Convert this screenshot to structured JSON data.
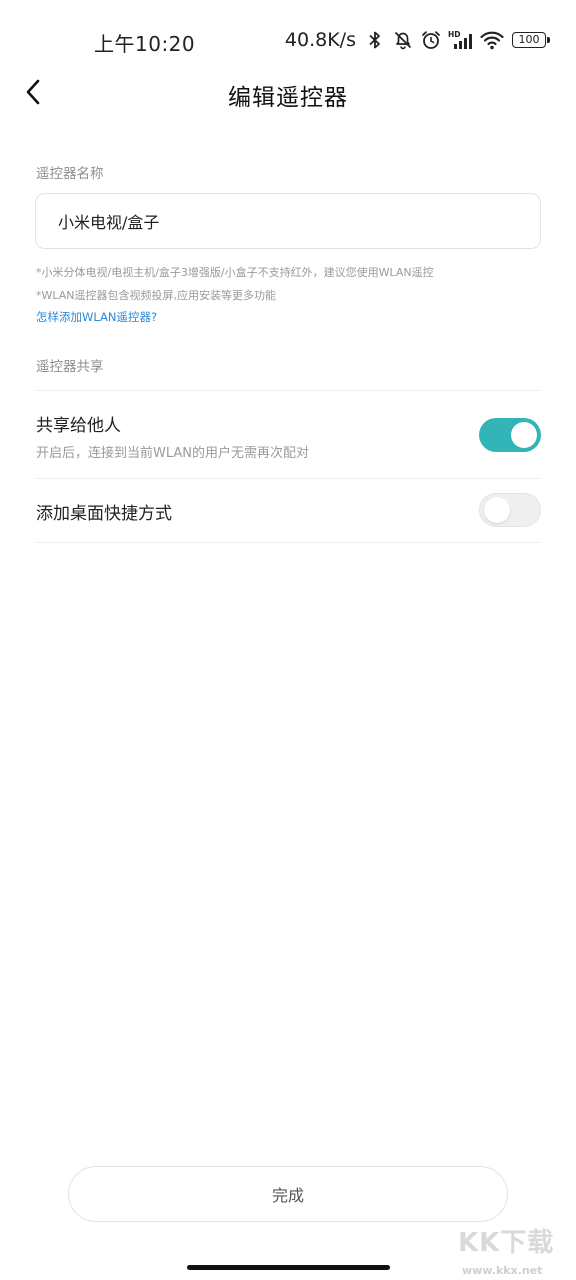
{
  "status_bar": {
    "time": "上午10:20",
    "net_speed": "40.8K/s",
    "icons": [
      "bluetooth-icon",
      "bell-muted-icon",
      "alarm-icon",
      "hd-signal-icon",
      "wifi-icon"
    ],
    "battery": "100"
  },
  "header": {
    "title": "编辑遥控器",
    "back_icon": "chevron-left-icon"
  },
  "name_section": {
    "label": "遥控器名称",
    "input_value": "小米电视/盒子",
    "hints": [
      "*小米分体电视/电视主机/盒子3增强版/小盒子不支持红外，建议您使用WLAN遥控",
      "*WLAN遥控器包含视频投屏,应用安装等更多功能"
    ],
    "help_link": "怎样添加WLAN遥控器?"
  },
  "share_section": {
    "label": "遥控器共享",
    "share_row": {
      "title": "共享给他人",
      "subtitle": "开启后，连接到当前WLAN的用户无需再次配对",
      "enabled": true
    },
    "shortcut_row": {
      "title": "添加桌面快捷方式",
      "enabled": false
    }
  },
  "footer": {
    "done_label": "完成"
  },
  "watermark": {
    "logo": "KK下载",
    "url": "www.kkx.net"
  },
  "colors": {
    "accent": "#33b5b8",
    "link": "#2a88d8"
  }
}
